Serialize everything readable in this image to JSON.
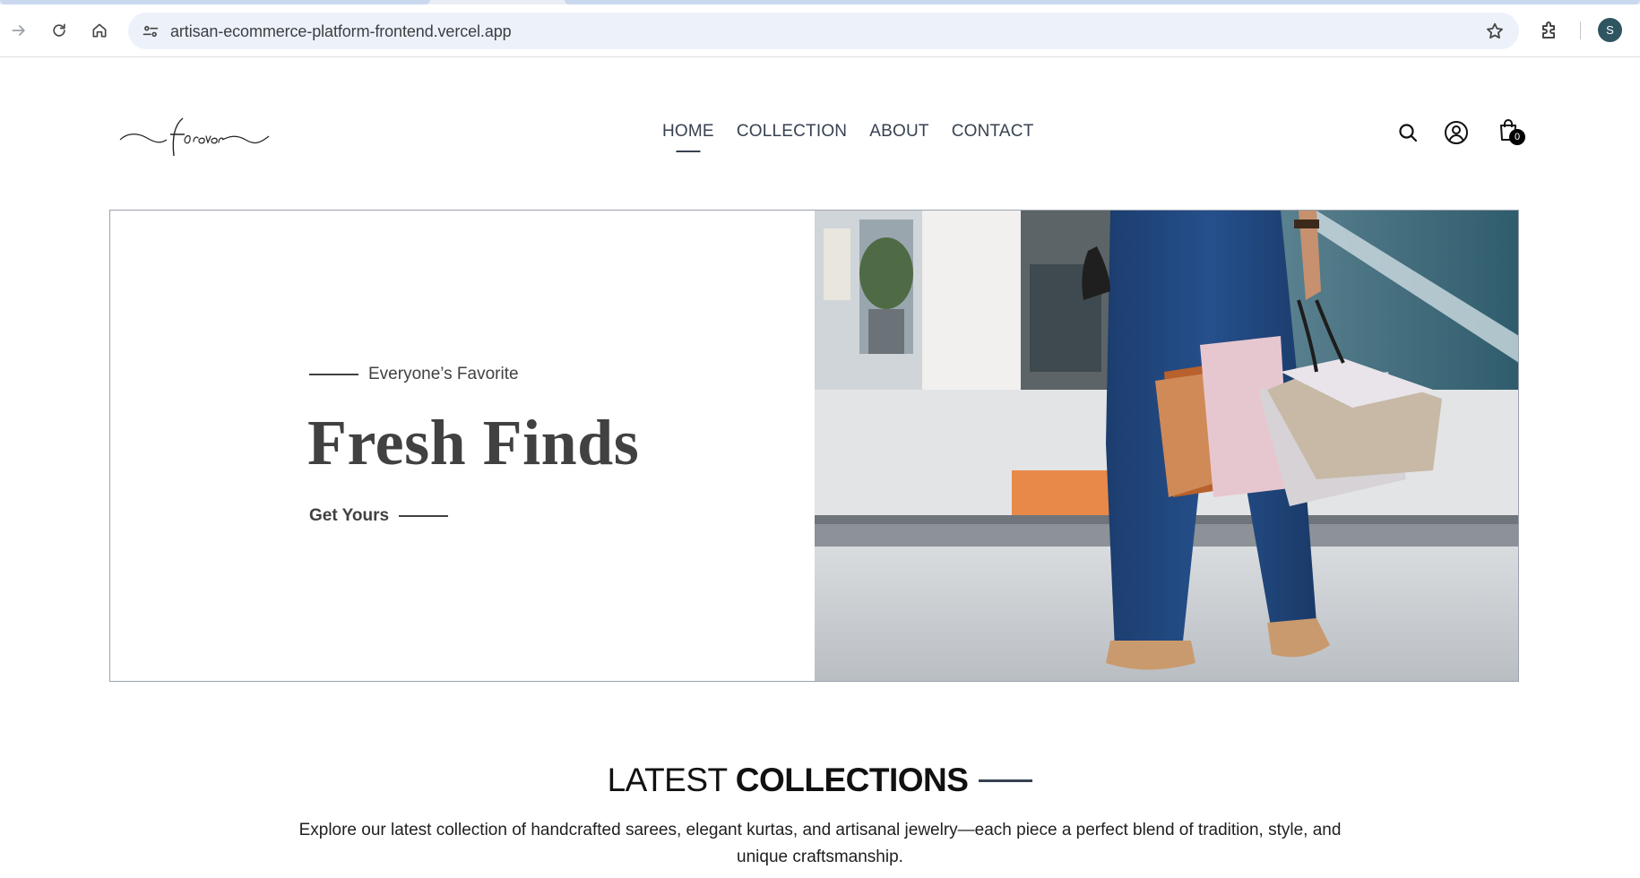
{
  "browser": {
    "url": "artisan-ecommerce-platform-frontend.vercel.app",
    "profile_initial": "S",
    "icons": [
      "forward-icon",
      "reload-icon",
      "home-icon",
      "site-info-icon",
      "bookmark-star-icon",
      "extensions-icon"
    ]
  },
  "header": {
    "logo_text": "forever",
    "nav": [
      {
        "label": "HOME",
        "active": true
      },
      {
        "label": "COLLECTION",
        "active": false
      },
      {
        "label": "ABOUT",
        "active": false
      },
      {
        "label": "CONTACT",
        "active": false
      }
    ],
    "cart_count": "0",
    "icons": [
      "search-icon",
      "profile-icon",
      "cart-icon"
    ]
  },
  "hero": {
    "eyebrow": "Everyone’s Favorite",
    "title": "Fresh Finds",
    "cta": "Get Yours",
    "image": "woman-with-shopping-bags"
  },
  "latest": {
    "title_light": "LATEST",
    "title_bold": "COLLECTIONS",
    "description": "Explore our latest collection of handcrafted sarees, elegant kurtas, and artisanal jewelry—each piece a perfect blend of tradition, style, and unique craftsmanship."
  },
  "colors": {
    "text_dark": "#414141",
    "nav_text": "#374151",
    "omnibox_bg": "#edf2fa",
    "avatar_bg": "#2f5561"
  }
}
